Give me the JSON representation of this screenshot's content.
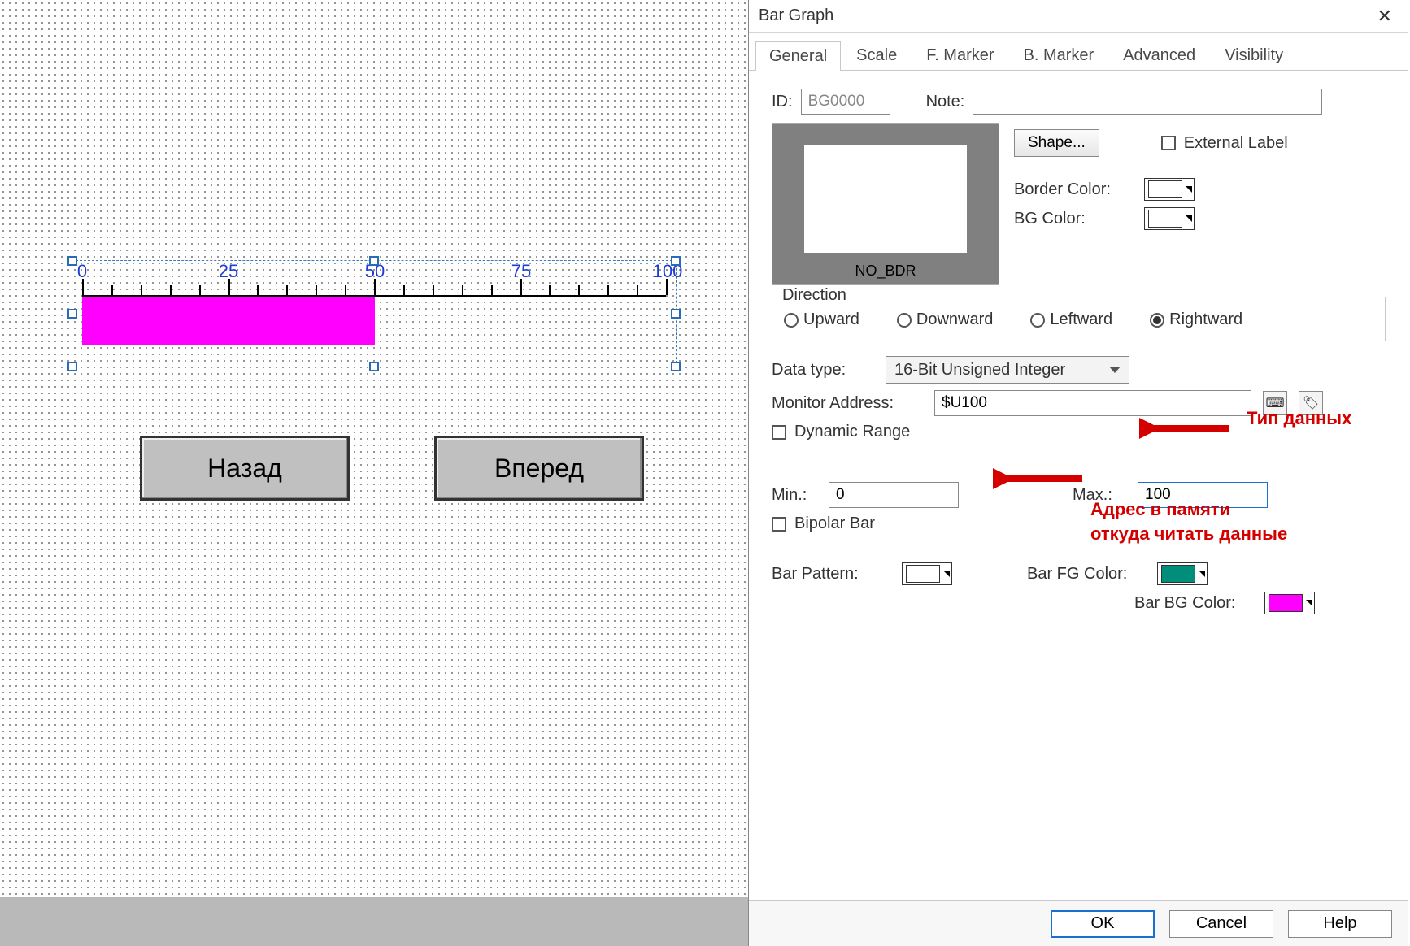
{
  "canvas": {
    "scale_labels": {
      "v0": "0",
      "v25": "25",
      "v50": "50",
      "v75": "75",
      "v100": "100"
    },
    "button_back": "Назад",
    "button_fwd": "Вперед"
  },
  "dialog": {
    "title": "Bar Graph",
    "tabs": {
      "general": "General",
      "scale": "Scale",
      "fmarker": "F. Marker",
      "bmarker": "B. Marker",
      "advanced": "Advanced",
      "visibility": "Visibility"
    },
    "id_label": "ID:",
    "id_value": "BG0000",
    "note_label": "Note:",
    "note_value": "",
    "shape_btn": "Shape...",
    "external_label": "External Label",
    "border_color_label": "Border Color:",
    "bg_color_label": "BG Color:",
    "preview_caption": "NO_BDR",
    "direction": {
      "title": "Direction",
      "upward": "Upward",
      "downward": "Downward",
      "leftward": "Leftward",
      "rightward": "Rightward",
      "selected": "rightward"
    },
    "data_type_label": "Data type:",
    "data_type_value": "16-Bit Unsigned Integer",
    "monitor_label": "Monitor Address:",
    "monitor_value": "$U100",
    "dynamic_range": "Dynamic Range",
    "min_label": "Min.:",
    "min_value": "0",
    "max_label": "Max.:",
    "max_value": "100",
    "bipolar": "Bipolar Bar",
    "bar_pattern_label": "Bar Pattern:",
    "bar_fg_label": "Bar FG Color:",
    "bar_bg_label": "Bar BG Color:",
    "colors": {
      "bar_fg": "#008e7a",
      "bar_bg": "#ff00ff",
      "border": "#ffffff",
      "bg": "#ffffff",
      "pattern": "#ffffff"
    },
    "buttons": {
      "ok": "OK",
      "cancel": "Cancel",
      "help": "Help"
    }
  },
  "annotations": {
    "type": "Тип данных",
    "addr1": "Адрес в памяти",
    "addr2": "откуда читать данные"
  }
}
